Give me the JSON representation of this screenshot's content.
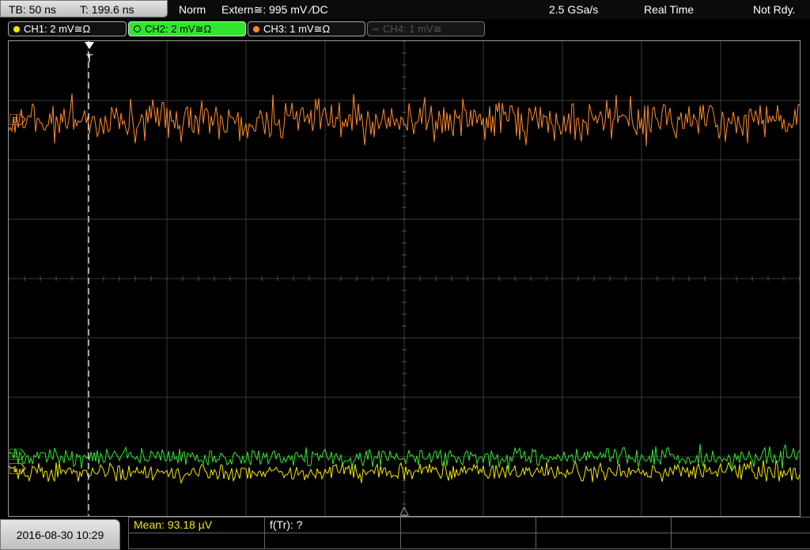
{
  "timebase": {
    "tb": "TB: 50 ns",
    "trigger_pos": "T: 199.6 ns"
  },
  "status": {
    "mode": "Norm",
    "trigger_source": "Extern≅: 995 mV ∕DC",
    "sample_rate": "2.5 GSa/s",
    "acq_mode": "Real Time",
    "state": "Not Rdy."
  },
  "channels": [
    {
      "label": "CH1: 2 mV≅Ω",
      "color": "#f2e600",
      "state": "inactive"
    },
    {
      "label": "CH2: 2 mV≅Ω",
      "color": "#2fe62f",
      "state": "active"
    },
    {
      "label": "CH3: 1 mV≅Ω",
      "color": "#ff8a2a",
      "state": "inactive"
    },
    {
      "label": "CH4: 1 mV≅",
      "color": "#555555",
      "state": "disabled"
    }
  ],
  "trigger_marker": "T",
  "markers": {
    "ch1": "1",
    "ch2": "2",
    "ch3": "3"
  },
  "measurements": {
    "mean": "Mean: 93.18 µV",
    "ftr": "f(Tr): ?"
  },
  "datetime": "2016-08-30 10:29",
  "colors": {
    "grid": "#3a3a3a",
    "ch1": "#f2e600",
    "ch2": "#2fe62f",
    "ch3": "#ff8a2a",
    "measure_text": "#f2e600"
  }
}
